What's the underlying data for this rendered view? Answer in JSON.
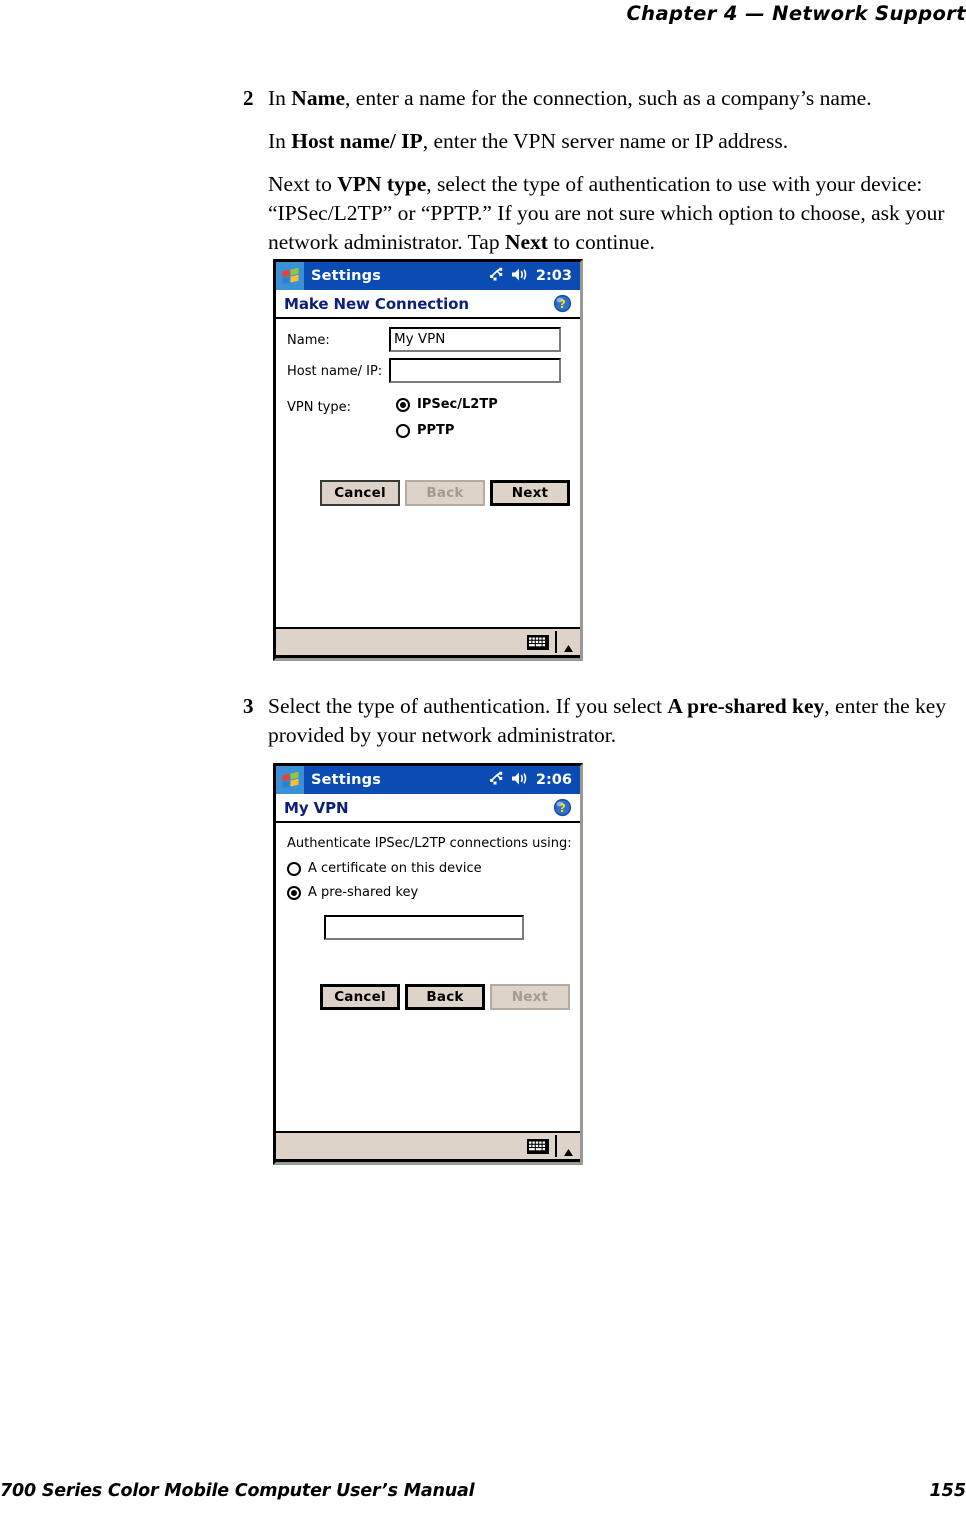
{
  "page": {
    "running_head": "Chapter  4  —  Network Support",
    "footer_title": "700 Series Color Mobile Computer User’s Manual",
    "footer_page": "155"
  },
  "steps": [
    {
      "number": "2",
      "paragraphs": [
        {
          "runs": [
            {
              "t": "In ",
              "b": false
            },
            {
              "t": "Name",
              "b": true
            },
            {
              "t": ", enter a name for the connection, such as a company’s name.",
              "b": false
            }
          ]
        },
        {
          "runs": [
            {
              "t": "In ",
              "b": false
            },
            {
              "t": "Host name/ IP",
              "b": true
            },
            {
              "t": ", enter the VPN server name or IP address.",
              "b": false
            }
          ]
        },
        {
          "runs": [
            {
              "t": "Next to ",
              "b": false
            },
            {
              "t": "VPN type",
              "b": true
            },
            {
              "t": ", select the type of authentication to use with your device: “IPSec/L2TP” or “PPTP.” If you are not sure which option to choose, ask your network administrator. Tap ",
              "b": false
            },
            {
              "t": "Next",
              "b": true
            },
            {
              "t": " to continue.",
              "b": false
            }
          ]
        }
      ]
    },
    {
      "number": "3",
      "paragraphs": [
        {
          "runs": [
            {
              "t": "Select the type of authentication. If you select ",
              "b": false
            },
            {
              "t": "A pre-shared key",
              "b": true
            },
            {
              "t": ", enter the key provided by your network administrator.",
              "b": false
            }
          ]
        }
      ]
    }
  ],
  "screenshot1": {
    "titlebar": {
      "app_name": "Settings",
      "clock": "2:03",
      "connectivity_icon": "connectivity-icon",
      "volume_icon": "speaker-icon",
      "logo_icon": "windows-logo-icon"
    },
    "caption": "Make New Connection",
    "help_icon": "help-question-icon",
    "fields": [
      {
        "label": "Name:",
        "value": "My VPN"
      },
      {
        "label": "Host name/ IP:",
        "value": ""
      }
    ],
    "vpn_type": {
      "label": "VPN type:",
      "options": [
        {
          "label": "IPSec/L2TP",
          "selected": true
        },
        {
          "label": "PPTP",
          "selected": false
        }
      ]
    },
    "buttons": [
      {
        "label": "Cancel",
        "state": "normal"
      },
      {
        "label": "Back",
        "state": "disabled"
      },
      {
        "label": "Next",
        "state": "default"
      }
    ],
    "sip": {
      "keyboard_icon": "keyboard-icon",
      "arrow_icon": "chevron-up-icon"
    }
  },
  "screenshot2": {
    "titlebar": {
      "app_name": "Settings",
      "clock": "2:06",
      "connectivity_icon": "connectivity-icon",
      "volume_icon": "speaker-icon",
      "logo_icon": "windows-logo-icon"
    },
    "caption": "My VPN",
    "help_icon": "help-question-icon",
    "prompt": "Authenticate IPSec/L2TP connections using:",
    "auth_options": [
      {
        "label": "A certificate on this device",
        "selected": false
      },
      {
        "label": "A pre-shared key",
        "selected": true
      }
    ],
    "key_field": {
      "value": ""
    },
    "buttons": [
      {
        "label": "Cancel",
        "state": "normal"
      },
      {
        "label": "Back",
        "state": "normal"
      },
      {
        "label": "Next",
        "state": "disabled"
      }
    ],
    "sip": {
      "keyboard_icon": "keyboard-icon",
      "arrow_icon": "chevron-up-icon"
    }
  },
  "colors": {
    "titlebar_blue": "#0a4cb4",
    "caption_text": "#0d1f7a",
    "button_face": "#ded3c9",
    "disabled_text": "#a49a90"
  }
}
